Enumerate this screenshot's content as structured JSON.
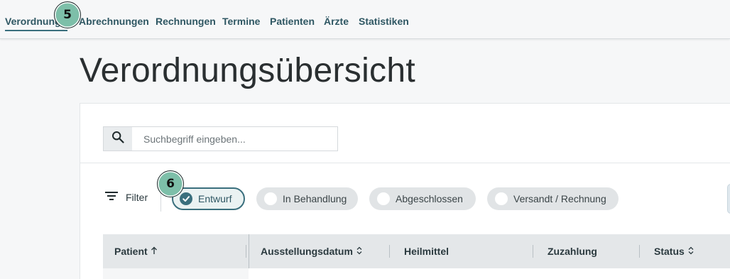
{
  "nav": {
    "items": [
      {
        "label": "Verordnungen",
        "active": true
      },
      {
        "label": "Abrechnungen"
      },
      {
        "label": "Rechnungen"
      },
      {
        "label": "Termine"
      },
      {
        "label": "Patienten"
      },
      {
        "label": "Ärzte"
      },
      {
        "label": "Statistiken"
      }
    ]
  },
  "badges": {
    "nav": "5",
    "filter": "6"
  },
  "page": {
    "title": "Verordnungsübersicht"
  },
  "search": {
    "placeholder": "Suchbegriff eingeben...",
    "value": "",
    "icon": "search-icon"
  },
  "filter": {
    "label": "Filter",
    "icon": "filter-lines-icon",
    "chips": [
      {
        "label": "Entwurf",
        "selected": true
      },
      {
        "label": "In Behandlung",
        "selected": false
      },
      {
        "label": "Abgeschlossen",
        "selected": false
      },
      {
        "label": "Versandt / Rechnung",
        "selected": false
      }
    ]
  },
  "table": {
    "columns": [
      {
        "label": "Patient",
        "sort": "ascending"
      },
      {
        "label": "Ausstellungsdatum",
        "sort": "sortable"
      },
      {
        "label": "Heilmittel"
      },
      {
        "label": "Zuzahlung"
      },
      {
        "label": "Status",
        "sort": "sortable"
      }
    ]
  },
  "colors": {
    "accent": "#3a6f7d",
    "badge": "#7dbfa9",
    "chip": "#e1e4e6",
    "header": "#e4e7e9"
  }
}
